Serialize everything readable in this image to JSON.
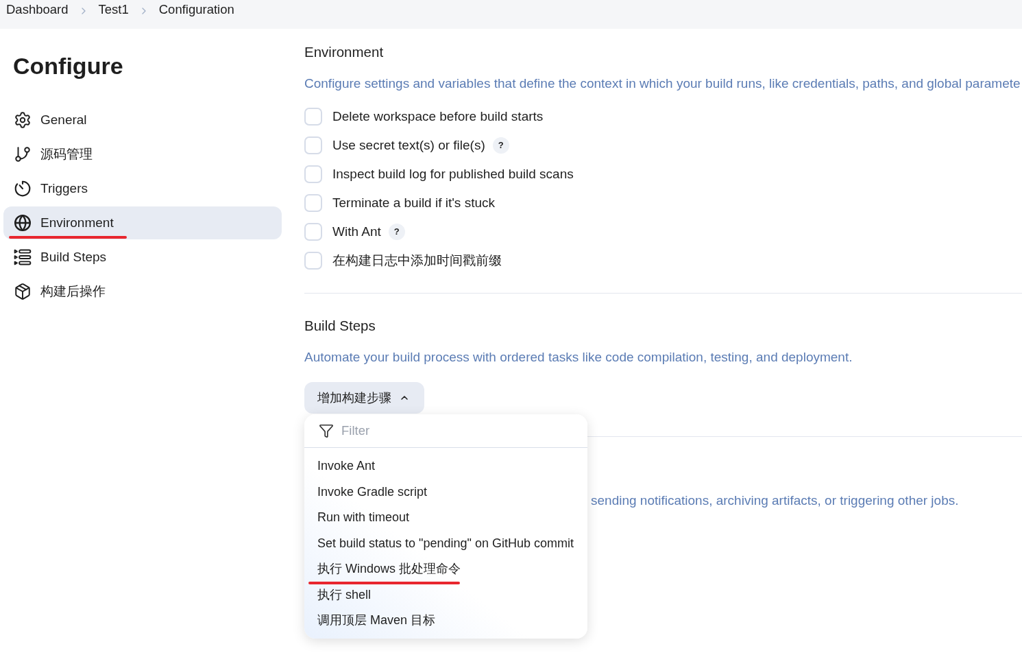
{
  "breadcrumbs": [
    {
      "label": "Dashboard"
    },
    {
      "label": "Test1"
    },
    {
      "label": "Configuration"
    }
  ],
  "sidebar": {
    "title": "Configure",
    "items": [
      {
        "label": "General",
        "selected": false,
        "underlined": false
      },
      {
        "label": "源码管理",
        "selected": false,
        "underlined": false
      },
      {
        "label": "Triggers",
        "selected": false,
        "underlined": false
      },
      {
        "label": "Environment",
        "selected": true,
        "underlined": true
      },
      {
        "label": "Build Steps",
        "selected": false,
        "underlined": false
      },
      {
        "label": "构建后操作",
        "selected": false,
        "underlined": false
      }
    ]
  },
  "environment": {
    "title": "Environment",
    "description": "Configure settings and variables that define the context in which your build runs, like credentials, paths, and global paramete",
    "options": [
      {
        "label": "Delete workspace before build starts",
        "checked": false
      },
      {
        "label": "Use secret text(s) or file(s)",
        "checked": false,
        "help": "?"
      },
      {
        "label": "Inspect build log for published build scans",
        "checked": false
      },
      {
        "label": "Terminate a build if it's stuck",
        "checked": false
      },
      {
        "label": "With Ant",
        "checked": false,
        "help": "?"
      },
      {
        "label": "在构建日志中添加时间戳前缀",
        "checked": false
      }
    ]
  },
  "build_steps": {
    "title": "Build Steps",
    "description": "Automate your build process with ordered tasks like code compilation, testing, and deployment.",
    "add_button": {
      "label": "增加构建步骤",
      "expanded": true
    },
    "menu": {
      "placeholder": "Filter",
      "items": [
        {
          "label": "Invoke Ant",
          "underlined": false
        },
        {
          "label": "Invoke Gradle script",
          "underlined": false
        },
        {
          "label": "Run with timeout",
          "underlined": false
        },
        {
          "label": "Set build status to \"pending\" on GitHub commit",
          "underlined": false
        },
        {
          "label": "执行 Windows 批处理命令",
          "underlined": true
        },
        {
          "label": "执行 shell",
          "underlined": false
        },
        {
          "label": "调用顶层 Maven 目标",
          "underlined": false
        }
      ]
    }
  },
  "post_build": {
    "description": "sending notifications, archiving artifacts, or triggering other jobs."
  }
}
